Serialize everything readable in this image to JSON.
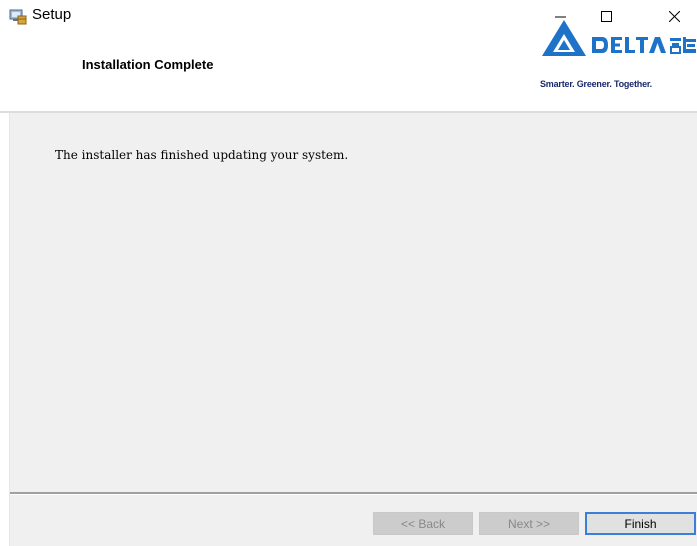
{
  "window": {
    "title": "Setup",
    "controls": {
      "minimize": "minimize-icon",
      "maximize": "maximize-icon",
      "close": "close-icon"
    }
  },
  "header": {
    "title": "Installation Complete",
    "logo": {
      "brand": "DELTA",
      "chinese": "台達",
      "tagline": "Smarter. Greener. Together."
    }
  },
  "body": {
    "message": "The installer has finished updating your system."
  },
  "footer": {
    "back_label": "<< Back",
    "next_label": "Next >>",
    "finish_label": "Finish"
  },
  "colors": {
    "accent": "#3c7fd6",
    "brand_blue": "#1e73c8",
    "panel_bg": "#f0f0f0"
  }
}
